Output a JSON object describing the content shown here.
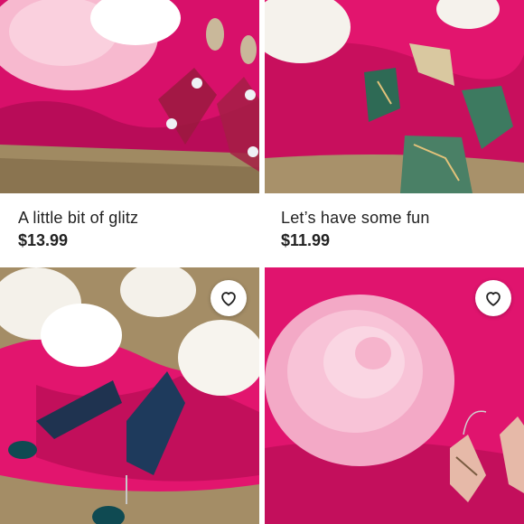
{
  "listings": [
    {
      "title": "A little bit of glitz",
      "price": "$13.99",
      "image": "pink-glitter-earrings-photo"
    },
    {
      "title": "Let’s have some fun",
      "price": "$11.99",
      "image": "green-marble-earrings-photo"
    },
    {
      "image": "navy-diamond-earrings-photo",
      "favorite_icon": "heart-outline-icon"
    },
    {
      "image": "pink-marble-earrings-photo",
      "favorite_icon": "heart-outline-icon"
    }
  ],
  "colors": {
    "text": "#222222",
    "background": "#ffffff",
    "fabric_pink": "#e0146e"
  }
}
